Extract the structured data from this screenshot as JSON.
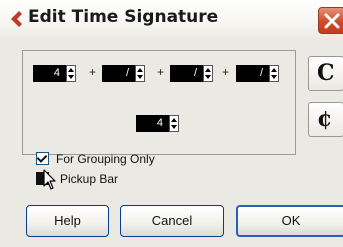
{
  "window": {
    "title": "Edit Time Signature",
    "close_label": "Close"
  },
  "signature": {
    "numerators": [
      "4",
      "/",
      "/",
      "/"
    ],
    "plus_signs": [
      "+",
      "+",
      "+"
    ],
    "denominator": "4"
  },
  "side_buttons": {
    "common_time": "C",
    "cut_time": "¢"
  },
  "options": {
    "grouping_label": "For Grouping Only",
    "grouping_checked": true,
    "pickup_label": "Pickup Bar",
    "pickup_checked": false
  },
  "buttons": {
    "help": "Help",
    "cancel": "Cancel",
    "ok": "OK"
  },
  "colors": {
    "accent_icon": "#c0392b",
    "close_button": "#d04a2a",
    "button_border": "#0b3c8a"
  }
}
